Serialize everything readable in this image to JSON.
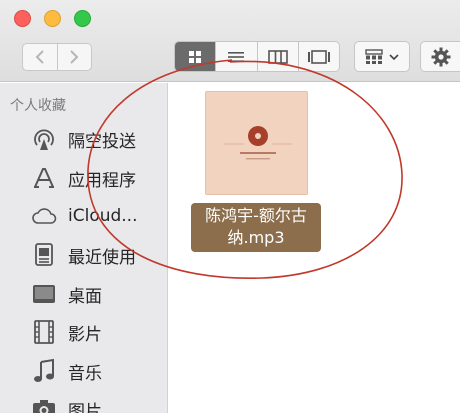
{
  "toolbar": {
    "traffic_lights": [
      {
        "name": "close",
        "color": "#fc615d"
      },
      {
        "name": "minimize",
        "color": "#fdbc40"
      },
      {
        "name": "zoom",
        "color": "#34c84a"
      }
    ],
    "nav": {
      "back_icon": "chevron-left-icon",
      "forward_icon": "chevron-right-icon"
    },
    "view_modes": [
      {
        "name": "icon-view",
        "active": true
      },
      {
        "name": "list-view",
        "active": false
      },
      {
        "name": "column-view",
        "active": false
      },
      {
        "name": "cover-flow-view",
        "active": false
      }
    ],
    "arrange_icon": "arrange-grid-icon",
    "action_icon": "gear-icon"
  },
  "sidebar": {
    "heading": "个人收藏",
    "items": [
      {
        "label": "隔空投送",
        "icon": "airdrop-icon"
      },
      {
        "label": "应用程序",
        "icon": "applications-icon"
      },
      {
        "label": "iCloud...",
        "icon": "icloud-icon"
      },
      {
        "label": "最近使用",
        "icon": "recents-icon"
      },
      {
        "label": "桌面",
        "icon": "desktop-icon"
      },
      {
        "label": "影片",
        "icon": "movies-icon"
      },
      {
        "label": "音乐",
        "icon": "music-icon"
      },
      {
        "label": "图片",
        "icon": "pictures-icon"
      }
    ]
  },
  "content": {
    "files": [
      {
        "name": "陈鸿宇-额尔古纳.mp3",
        "selected": true,
        "icon": "audio-file-thumbnail"
      }
    ]
  },
  "colors": {
    "sidebar_bg": "#e9e9ec",
    "selection_bg": "#8c6d4c",
    "annotation_circle": "#c0392b"
  }
}
